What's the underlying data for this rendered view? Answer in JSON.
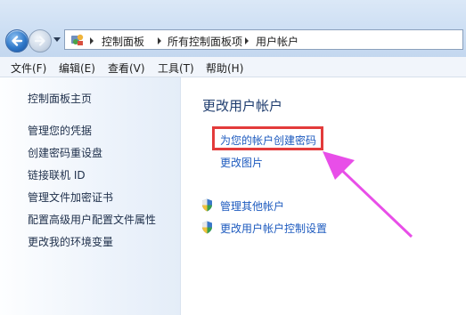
{
  "address": {
    "crumbs": [
      "控制面板",
      "所有控制面板项",
      "用户帐户"
    ]
  },
  "menubar": {
    "items": [
      "文件(F)",
      "编辑(E)",
      "查看(V)",
      "工具(T)",
      "帮助(H)"
    ]
  },
  "sidebar": {
    "home": "控制面板主页",
    "items": [
      "管理您的凭据",
      "创建密码重设盘",
      "链接联机 ID",
      "管理文件加密证书",
      "配置高级用户配置文件属性",
      "更改我的环境变量"
    ]
  },
  "main": {
    "title": "更改用户帐户",
    "create_password": "为您的帐户创建密码",
    "change_picture": "更改图片",
    "manage_other": "管理其他帐户",
    "uac_settings": "更改用户帐户控制设置"
  },
  "colors": {
    "link": "#1e5bbf",
    "highlight": "#e33b3b",
    "arrow": "#e84ee8"
  },
  "icons": {
    "back": "back-arrow-icon",
    "forward": "forward-arrow-icon",
    "address": "control-panel-icon",
    "shield": "uac-shield-icon"
  }
}
